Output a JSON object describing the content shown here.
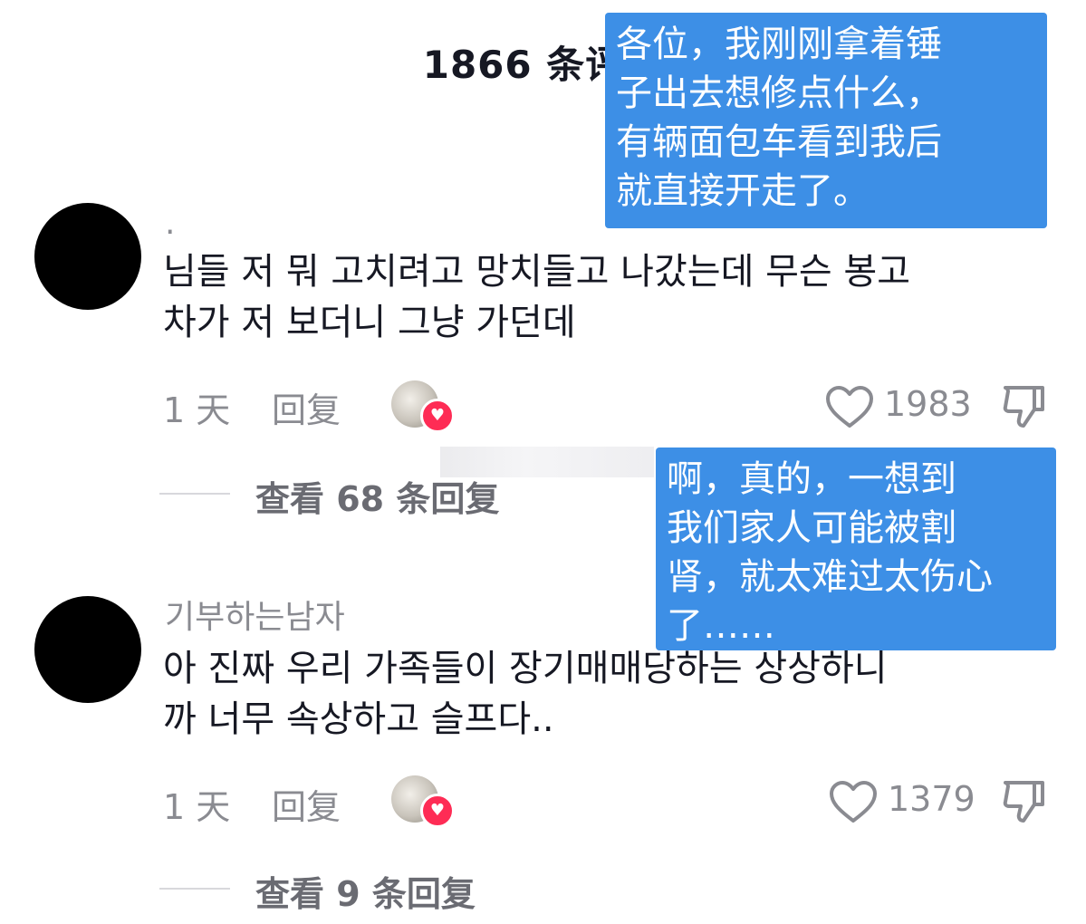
{
  "header": {
    "title": "1866 条评论"
  },
  "comments": [
    {
      "username": ".",
      "text": "님들 저 뭐 고치려고 망치들고 나갔는데 무슨 봉고\n차가 저 보더니 그냥 가던데",
      "time": "1 天",
      "reply_label": "回复",
      "likes": "1983",
      "view_replies": "查看 68 条回复"
    },
    {
      "username": "기부하는남자",
      "text": "아 진짜 우리 가족들이 장기매매당하는 상상하니\n까 너무 속상하고 슬프다..",
      "time": "1 天",
      "reply_label": "回复",
      "likes": "1379",
      "view_replies": "查看 9 条回复"
    }
  ],
  "translations": [
    {
      "text": "各位，我刚刚拿着锤\n子出去想修点什么，\n有辆面包车看到我后\n就直接开走了。"
    },
    {
      "text": "啊，真的，一想到\n我们家人可能被割\n肾，就太难过太伤心\n了……"
    }
  ],
  "colors": {
    "overlay": "#3d8fe6",
    "heart": "#fe2c55",
    "muted": "#8a8b91"
  },
  "icons": [
    "heart-outline-icon",
    "thumbs-down-icon",
    "reaction-heart-icon"
  ]
}
